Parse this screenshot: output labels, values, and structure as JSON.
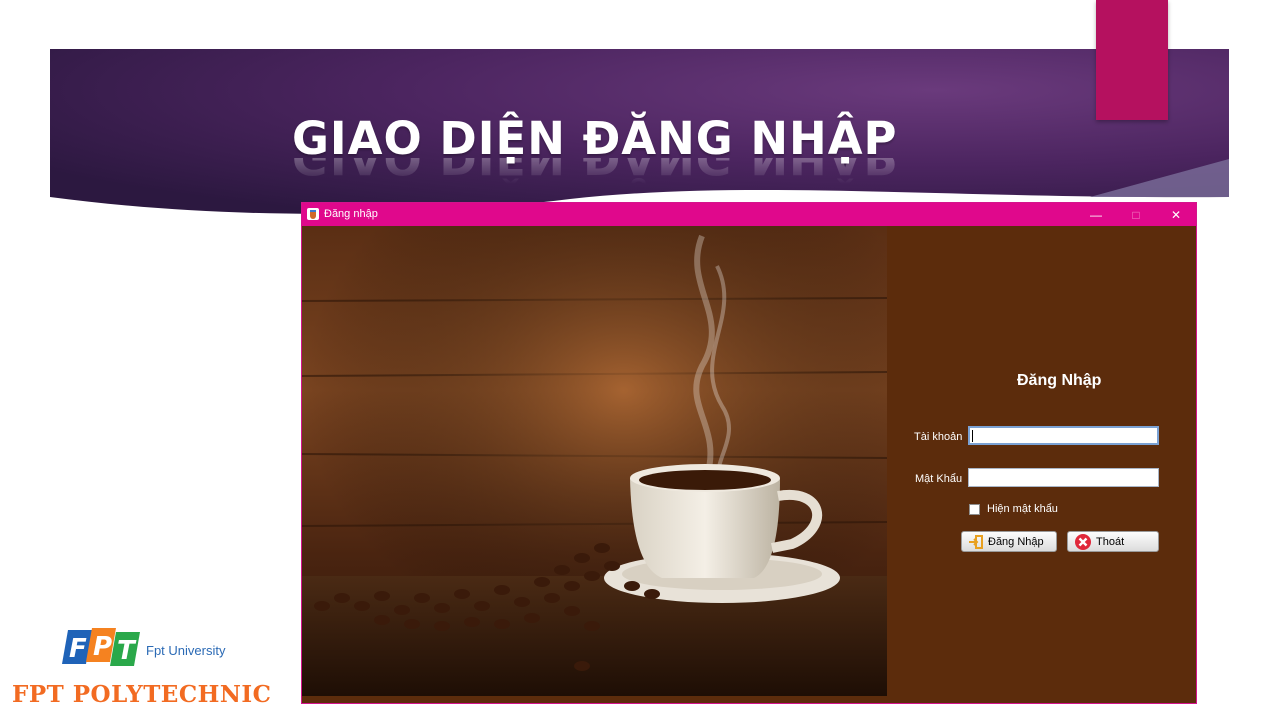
{
  "slide": {
    "title": "GIAO DIỆN ĐĂNG NHẬP"
  },
  "window": {
    "title": "Đăng nhập",
    "controls": {
      "minimize": "—",
      "maximize": "□",
      "close": "✕"
    }
  },
  "login_form": {
    "heading": "Đăng Nhập",
    "username_label": "Tài khoản",
    "username_value": "",
    "password_label": "Mật Khẩu",
    "password_value": "",
    "show_password_label": "Hiện mật khẩu",
    "show_password_checked": false,
    "login_button": "Đăng Nhập",
    "exit_button": "Thoát"
  },
  "logo": {
    "letters": "FPT",
    "university": "Fpt University",
    "polytechnic": "FPT POLYTECHNIC"
  },
  "colors": {
    "banner": "#4a2560",
    "accent_pink": "#b5115f",
    "titlebar": "#e0088c",
    "panel_brown": "#5c2c0c",
    "poly_orange": "#f26b22"
  },
  "icons": [
    "app-icon",
    "minimize-icon",
    "maximize-icon",
    "close-icon",
    "login-arrow-icon",
    "exit-x-icon",
    "fpt-logo"
  ]
}
